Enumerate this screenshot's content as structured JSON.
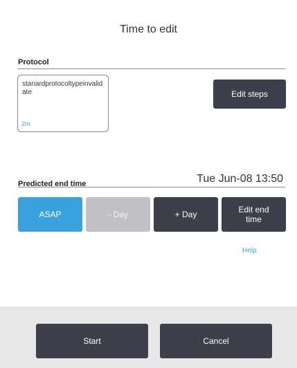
{
  "dialog": {
    "title": "Time to edit"
  },
  "protocol": {
    "label": "Protocol",
    "name": "stanardprotocoltypeinvalidate",
    "duration": "2m",
    "edit_steps_label": "Edit steps"
  },
  "predicted": {
    "label": "Predicted end time",
    "end_time": "Tue Jun-08 13:50"
  },
  "time_buttons": {
    "asap": "ASAP",
    "minus_day": "- Day",
    "plus_day": "+ Day",
    "edit_end_time": "Edit end time"
  },
  "help_label": "Help",
  "footer": {
    "start_label": "Start",
    "cancel_label": "Cancel"
  },
  "colors": {
    "accent": "#3ba2dd",
    "dark_button": "#3d3f4a",
    "disabled_button": "#c0c1c6",
    "footer_bg": "#e7e7e9"
  }
}
